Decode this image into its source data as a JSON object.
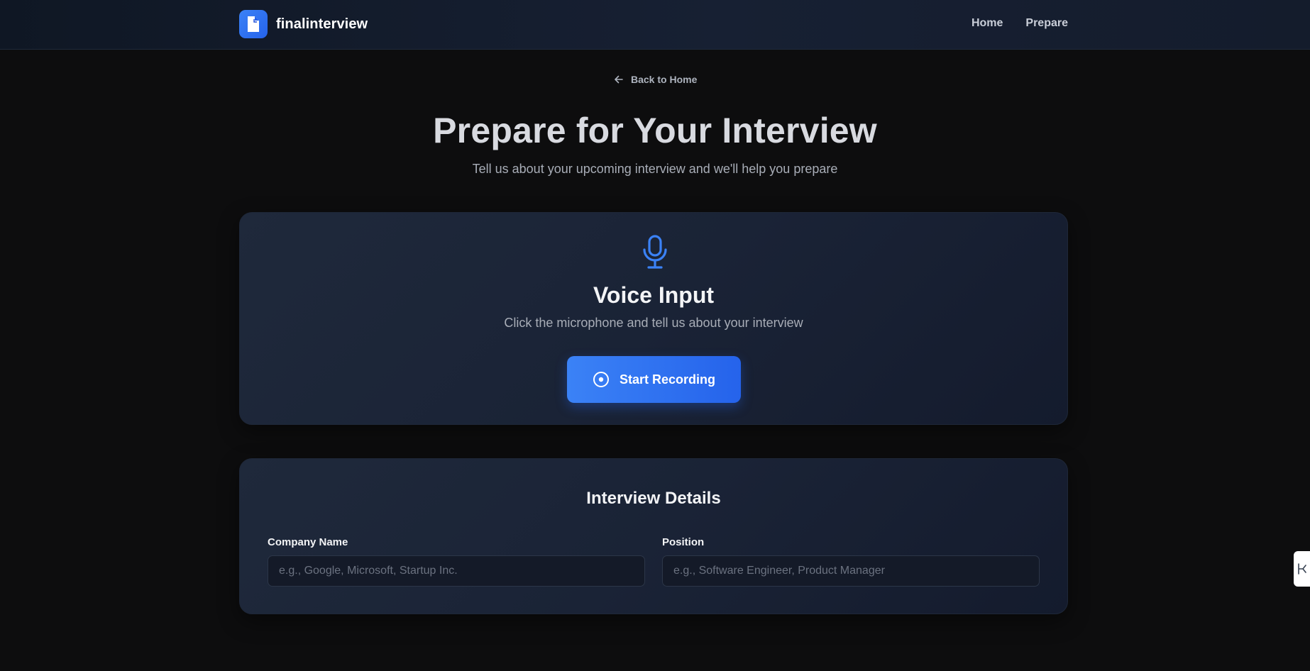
{
  "navbar": {
    "brand_name": "finalinterview",
    "links": [
      {
        "label": "Home"
      },
      {
        "label": "Prepare"
      }
    ]
  },
  "back_link": {
    "label": "Back to Home"
  },
  "page": {
    "title": "Prepare for Your Interview",
    "subtitle": "Tell us about your upcoming interview and we'll help you prepare"
  },
  "voice_card": {
    "title": "Voice Input",
    "subtitle": "Click the microphone and tell us about your interview",
    "button_label": "Start Recording"
  },
  "details_card": {
    "title": "Interview Details",
    "company": {
      "label": "Company Name",
      "value": "",
      "placeholder": "e.g., Google, Microsoft, Startup Inc."
    },
    "position": {
      "label": "Position",
      "value": "",
      "placeholder": "e.g., Software Engineer, Product Manager"
    }
  },
  "colors": {
    "accent": "#3b82f6",
    "accent_dark": "#2563eb",
    "background": "#0d0d0e",
    "card": "#1f293b"
  },
  "icons": {
    "brand": "document-icon",
    "back": "arrow-left-icon",
    "voice": "microphone-icon",
    "record": "record-icon",
    "side_widget": "side-widget-icon"
  }
}
